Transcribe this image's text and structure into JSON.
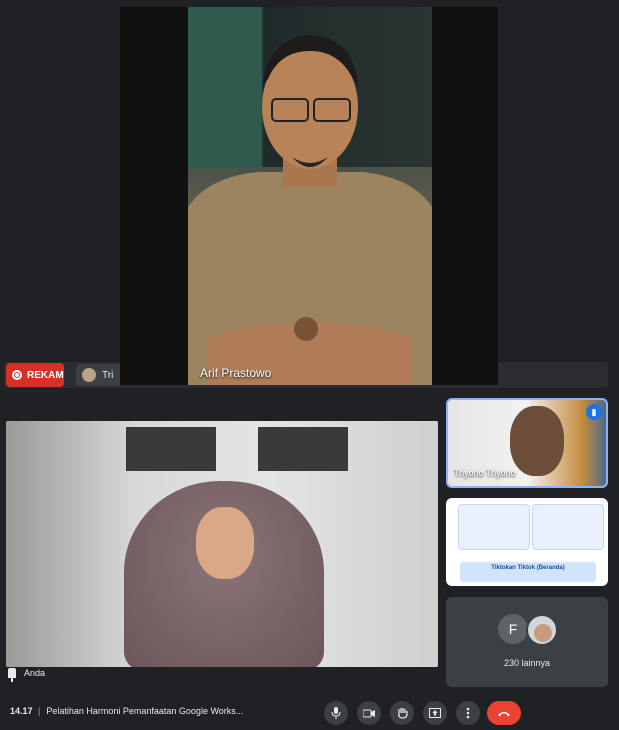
{
  "pip": {
    "name": "Arif Prastowo"
  },
  "top_bar": {
    "record_label": "REKAM",
    "presenter_chip": "Tri"
  },
  "main_tile": {
    "self_label": "Anda"
  },
  "side": {
    "tile1_label": "Triyono Triyono",
    "tile2_banner": "Tiktokan Tiktok (Beranda)",
    "f_initial": "F",
    "more_label": "230 lainnya"
  },
  "bottom": {
    "time": "14.17",
    "separator": "|",
    "title": "Pelatihan Harmoni Pemanfaatan Google Works..."
  },
  "colors": {
    "record": "#d93025",
    "end_call": "#ea4335",
    "active_border": "#8ab4f8"
  }
}
